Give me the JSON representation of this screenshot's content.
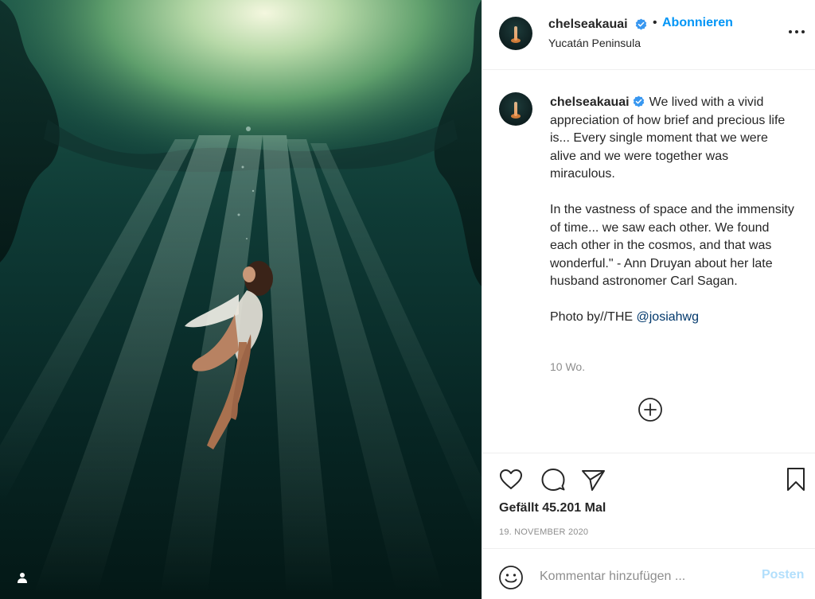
{
  "post": {
    "author": {
      "username": "chelseakauai",
      "verified": true,
      "location": "Yucatán Peninsula",
      "follow_label": "Abonnieren",
      "separator": "•"
    },
    "caption": {
      "username": "chelseakauai",
      "paragraphs": [
        "We lived with a vivid appreciation of how brief and precious life is... Every single moment that we were alive and we were together was miraculous.",
        "In the vastness of space and the immensity of time... we saw each other. We found each other in the cosmos, and that was wonderful.\" - Ann Druyan about her late husband astronomer Carl Sagan."
      ],
      "photo_credit_prefix": "Photo by//THE ",
      "photo_credit_mention": "@josiahwg",
      "time_ago": "10 Wo."
    },
    "likes_text": "Gefällt 45.201 Mal",
    "date": "19. NOVEMBER 2020",
    "comment": {
      "placeholder": "Kommentar hinzufügen ...",
      "post_label": "Posten"
    }
  },
  "icons": {
    "like": "heart-icon",
    "comment": "comment-bubble-icon",
    "share": "paper-plane-icon",
    "save": "bookmark-icon",
    "more": "more-options-icon",
    "load_more": "plus-circle-icon",
    "emoji": "emoji-icon",
    "tagged": "user-tag-icon",
    "verified": "verified-badge-icon"
  },
  "colors": {
    "accent": "#0095f6",
    "accent_disabled": "#b2dffc",
    "verified": "#3897f0",
    "mention": "#00376b",
    "muted": "#8e8e8e",
    "text": "#262626"
  }
}
